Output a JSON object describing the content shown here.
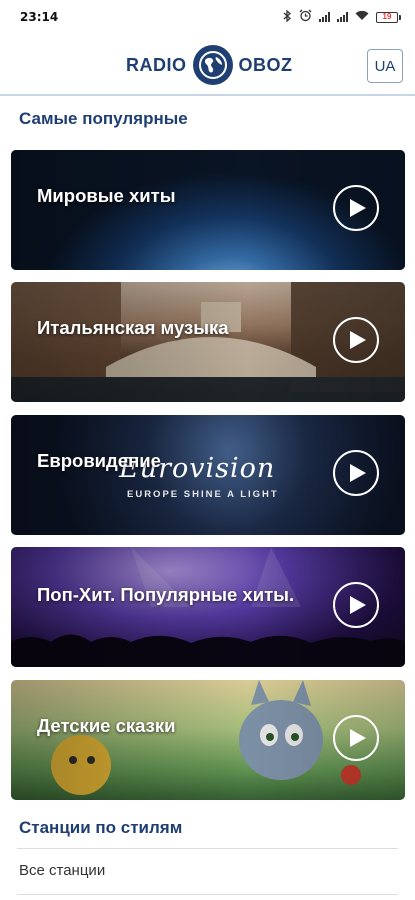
{
  "status_bar": {
    "time": "23:14",
    "battery_level": "19",
    "icons": [
      "bluetooth-icon",
      "alarm-icon",
      "signal-icon",
      "signal-icon",
      "wifi-icon",
      "battery-icon"
    ]
  },
  "header": {
    "logo_left": "RADIO",
    "logo_right": "OBOZ",
    "lang_button": "UA",
    "brand_color": "#1f3f73"
  },
  "popular": {
    "title": "Самые популярные",
    "cards": [
      {
        "title": "Мировые хиты",
        "icon": "play-icon"
      },
      {
        "title": "Итальянская музыка",
        "icon": "play-icon"
      },
      {
        "title": "Евровидение",
        "icon": "play-icon",
        "logo_text": "Eurovision",
        "logo_sub": "EUROPE SHINE A LIGHT"
      },
      {
        "title": "Поп-Хит. Популярные хиты.",
        "icon": "play-icon"
      },
      {
        "title": "Детские сказки",
        "icon": "play-icon"
      }
    ]
  },
  "styles": {
    "title": "Станции по стилям",
    "items": [
      "Все станции"
    ]
  }
}
